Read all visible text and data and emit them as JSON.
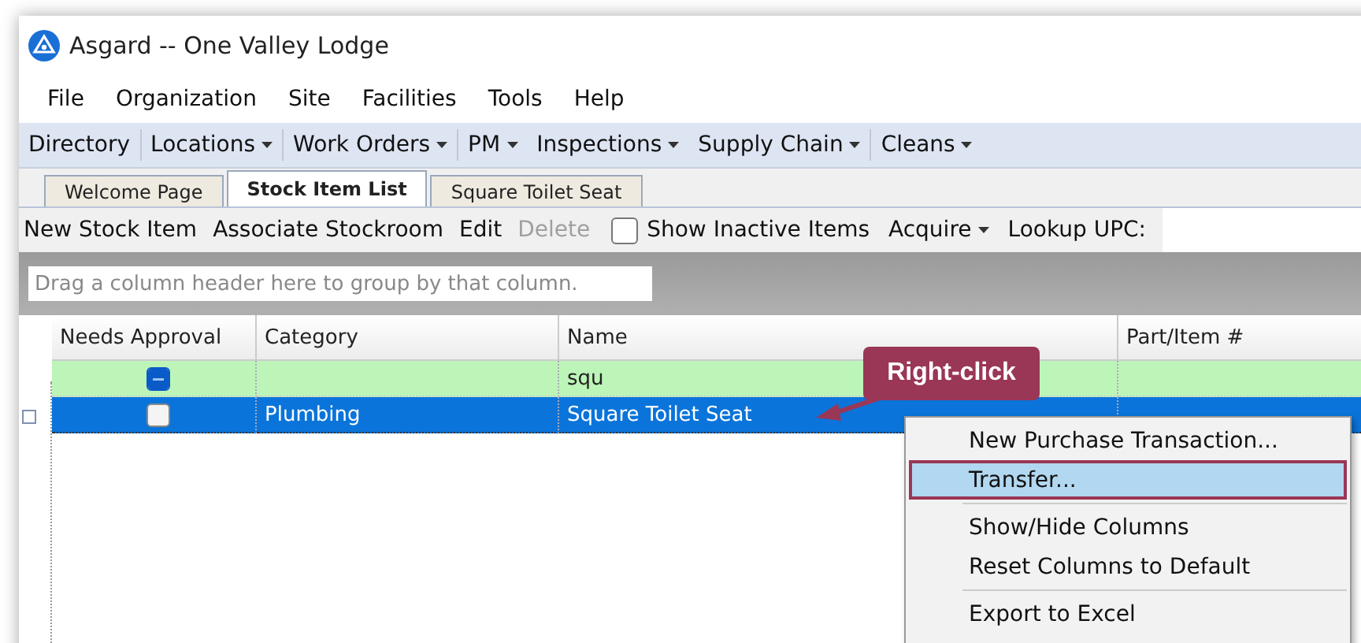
{
  "window": {
    "title": "Asgard -- One Valley Lodge"
  },
  "menu_bar": [
    "File",
    "Organization",
    "Site",
    "Facilities",
    "Tools",
    "Help"
  ],
  "nav_bar": [
    {
      "label": "Directory",
      "dropdown": false
    },
    {
      "label": "Locations",
      "dropdown": true
    },
    {
      "label": "Work Orders",
      "dropdown": true
    },
    {
      "label": "PM",
      "dropdown": true
    },
    {
      "label": "Inspections",
      "dropdown": true
    },
    {
      "label": "Supply Chain",
      "dropdown": true
    },
    {
      "label": "Cleans",
      "dropdown": true
    }
  ],
  "tabs": [
    {
      "label": "Welcome Page",
      "selected": false
    },
    {
      "label": "Stock Item List",
      "selected": true
    },
    {
      "label": "Square Toilet Seat",
      "selected": false
    }
  ],
  "toolstrip": {
    "items": [
      {
        "label": "New Stock Item",
        "disabled": false
      },
      {
        "label": "Associate Stockroom",
        "disabled": false
      },
      {
        "label": "Edit",
        "disabled": false
      },
      {
        "label": "Delete",
        "disabled": true
      }
    ],
    "show_inactive": {
      "label": "Show Inactive Items",
      "checked": false
    },
    "acquire": "Acquire",
    "lookup_label": "Lookup UPC:"
  },
  "group_area": {
    "placeholder": "Drag a column header here to group by that column."
  },
  "table": {
    "columns": [
      "Needs Approval",
      "Category",
      "Name",
      "Part/Item #"
    ],
    "rows": [
      {
        "kind": "filter",
        "approval_indeterminate": true,
        "category": "",
        "name": "squ",
        "part": "",
        "selected": false
      },
      {
        "kind": "data",
        "approval_checked": false,
        "category": "Plumbing",
        "name": "Square Toilet Seat",
        "part": "",
        "selected": true
      }
    ]
  },
  "callout": "Right-click",
  "context_menu": [
    {
      "label": "New Purchase Transaction...",
      "highlighted": false,
      "separator_before": false
    },
    {
      "label": "Transfer...",
      "highlighted": true,
      "separator_before": false
    },
    {
      "label": "Show/Hide Columns",
      "highlighted": false,
      "separator_before": true
    },
    {
      "label": "Reset Columns to Default",
      "highlighted": false,
      "separator_before": false
    },
    {
      "label": "Export to Excel",
      "highlighted": false,
      "separator_before": true
    }
  ]
}
